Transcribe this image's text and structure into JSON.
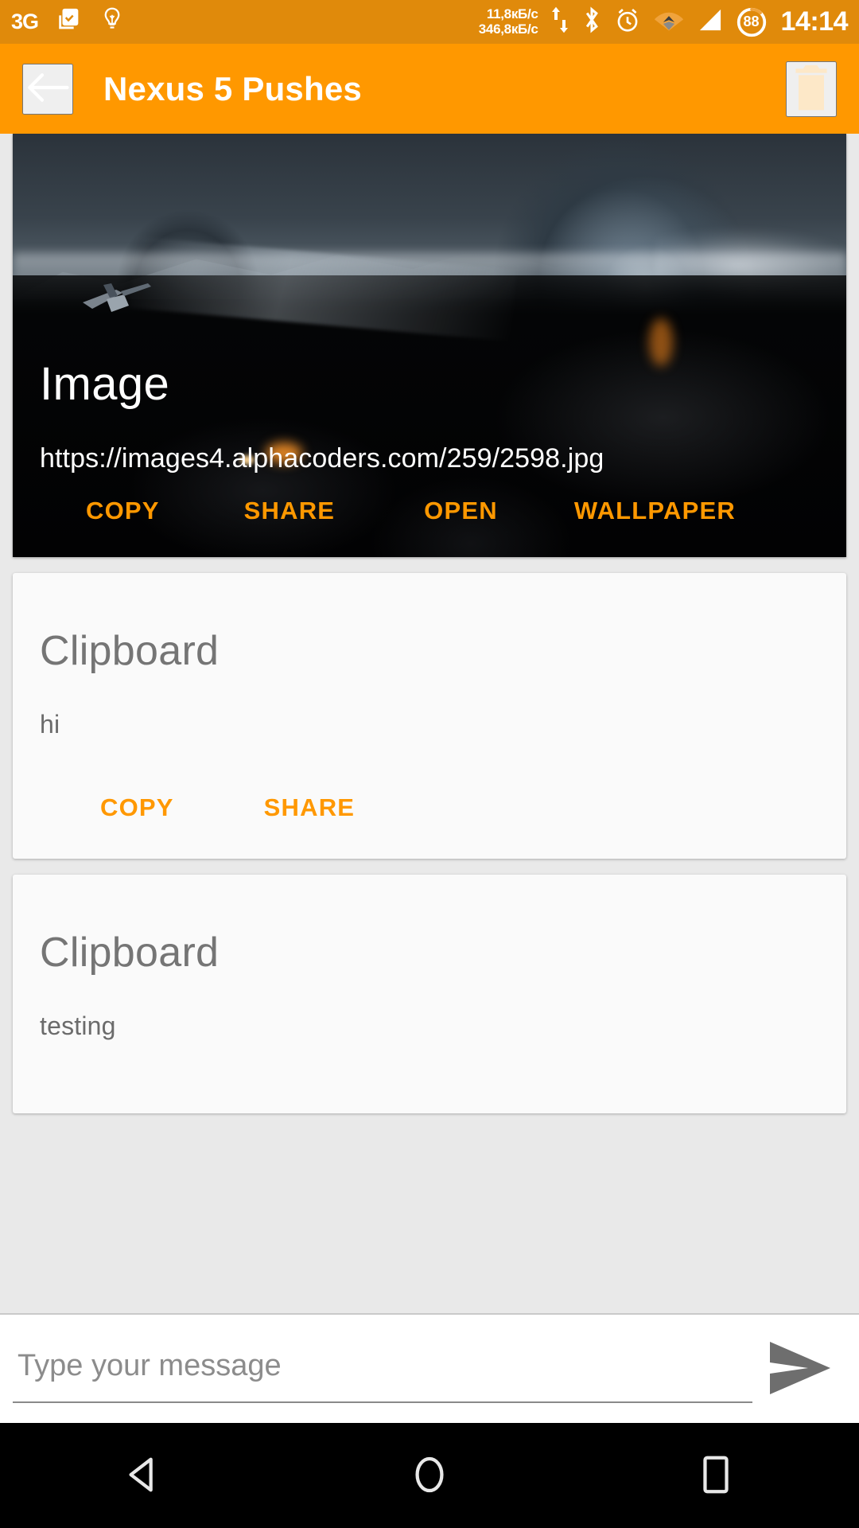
{
  "status_bar": {
    "network_type": "3G",
    "icons": [
      "clipboard-check-icon",
      "lightbulb-icon",
      "bluetooth-icon",
      "alarm-icon",
      "wifi-icon",
      "signal-icon"
    ],
    "upload_speed": "11,8кБ/с",
    "download_speed": "346,8кБ/с",
    "battery_level": "88",
    "time": "14:14",
    "background_color": "#e08a0b"
  },
  "app_bar": {
    "title": "Nexus 5 Pushes",
    "back_icon": "arrow-left-icon",
    "delete_icon": "trash-icon",
    "background_color": "#ff9800"
  },
  "cards": [
    {
      "type": "image",
      "title": "Image",
      "url": "https://images4.alphacoders.com/259/2598.jpg",
      "actions": [
        "COPY",
        "SHARE",
        "OPEN",
        "WALLPAPER"
      ],
      "accent_color": "#ff9800"
    },
    {
      "type": "clipboard",
      "title": "Clipboard",
      "body": "hi",
      "actions": [
        "COPY",
        "SHARE"
      ],
      "accent_color": "#ff9800"
    },
    {
      "type": "clipboard",
      "title": "Clipboard",
      "body": "testing",
      "actions": [],
      "accent_color": "#ff9800"
    }
  ],
  "message_bar": {
    "placeholder": "Type your message",
    "value": "",
    "send_icon": "send-icon"
  },
  "nav_bar": {
    "back": "triangle-back-icon",
    "home": "circle-home-icon",
    "recents": "square-recents-icon"
  }
}
